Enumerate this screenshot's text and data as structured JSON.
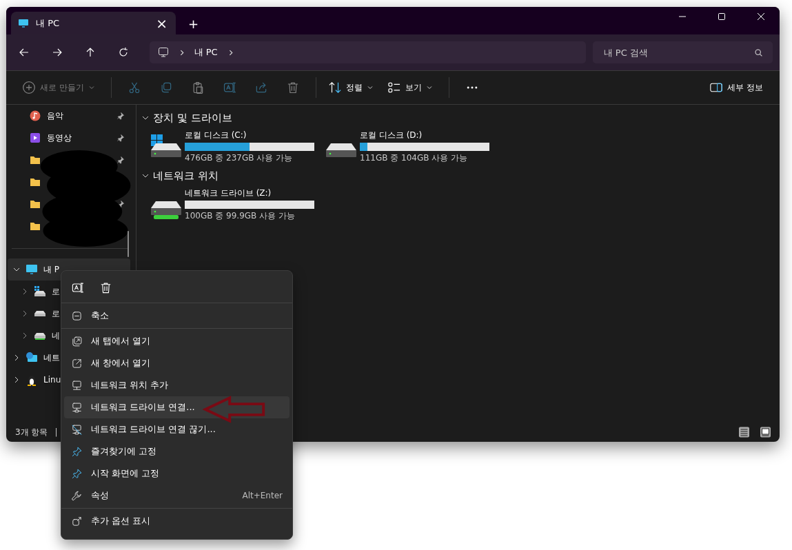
{
  "tab": {
    "title": "내 PC",
    "close": "×",
    "new_tab": "+"
  },
  "address": {
    "crumbs": [
      "내 PC"
    ],
    "search_placeholder": "내 PC 검색"
  },
  "toolbar": {
    "new_label": "새로 만들기",
    "new_disabled": true,
    "actions": [
      {
        "kind": "cut",
        "disabled": true
      },
      {
        "kind": "copy",
        "disabled": true
      },
      {
        "kind": "paste",
        "disabled": true
      },
      {
        "kind": "rename",
        "disabled": true
      },
      {
        "kind": "share",
        "disabled": true
      },
      {
        "kind": "delete",
        "disabled": true
      }
    ],
    "sort_label": "정렬",
    "view_label": "보기",
    "details_label": "세부 정보"
  },
  "sidebar": {
    "quick_access": [
      {
        "kind": "music",
        "label": "음악",
        "pinned": true
      },
      {
        "kind": "video",
        "label": "동영상",
        "pinned": true
      },
      {
        "kind": "folder",
        "pinned": true
      },
      {
        "kind": "folder"
      },
      {
        "kind": "folder",
        "pinned": true
      },
      {
        "kind": "folder"
      }
    ],
    "tree": [
      {
        "kind": "pc",
        "label": "내 P",
        "expanded": true,
        "selected": true,
        "children": [
          {
            "kind": "windows-drive",
            "label": "로",
            "expanded": false,
            "selected": false
          },
          {
            "kind": "drive",
            "label": "로",
            "expanded": false,
            "selected": false
          },
          {
            "kind": "network-drive",
            "label": "네",
            "expanded": false,
            "selected": false
          }
        ]
      },
      {
        "kind": "network",
        "label": "네트",
        "expanded": false,
        "selected": false
      },
      {
        "kind": "linux",
        "label": "Linu",
        "expanded": false,
        "selected": false
      }
    ]
  },
  "sections": [
    {
      "title": "장치 및 드라이브",
      "expanded": true,
      "drives": [
        {
          "kind": "windows-drive",
          "name": "로컬 디스크 (C:)",
          "level": 0.5,
          "space": "476GB 중 237GB 사용 가능"
        },
        {
          "kind": "drive",
          "name": "로컬 디스크 (D:)",
          "level": 0.06,
          "space": "111GB 중 104GB 사용 가능"
        }
      ]
    },
    {
      "title": "네트워크 위치",
      "expanded": true,
      "drives": [
        {
          "kind": "network-drive",
          "name": "네트워크 드라이브 (Z:)",
          "space": "100GB 중 99.9GB 사용 가능"
        }
      ]
    }
  ],
  "status_bar": {
    "count": "3개 항목",
    "separator": "|"
  },
  "context_menu": {
    "top_actions": [
      {
        "kind": "rename"
      },
      {
        "kind": "delete"
      }
    ],
    "groups": [
      [
        {
          "kind": "collapse",
          "label": "축소",
          "selected": false
        }
      ],
      [
        {
          "kind": "open-tab",
          "label": "새 탭에서 열기",
          "selected": false
        },
        {
          "kind": "open-window",
          "label": "새 창에서 열기",
          "selected": false
        },
        {
          "kind": "add-network",
          "label": "네트워크 위치 추가",
          "selected": false
        },
        {
          "kind": "map-drive",
          "label": "네트워크 드라이브 연결...",
          "selected": true
        },
        {
          "kind": "unmap-drive",
          "label": "네트워크 드라이브 연결 끊기...",
          "selected": false
        },
        {
          "kind": "pin",
          "label": "즐겨찾기에 고정",
          "selected": false
        },
        {
          "kind": "pin",
          "label": "시작 화면에 고정",
          "selected": false
        },
        {
          "kind": "wrench",
          "label": "속성",
          "shortcut": "Alt+Enter",
          "selected": false
        }
      ],
      [
        {
          "kind": "more",
          "label": "추가 옵션 표시",
          "selected": false
        }
      ]
    ]
  }
}
